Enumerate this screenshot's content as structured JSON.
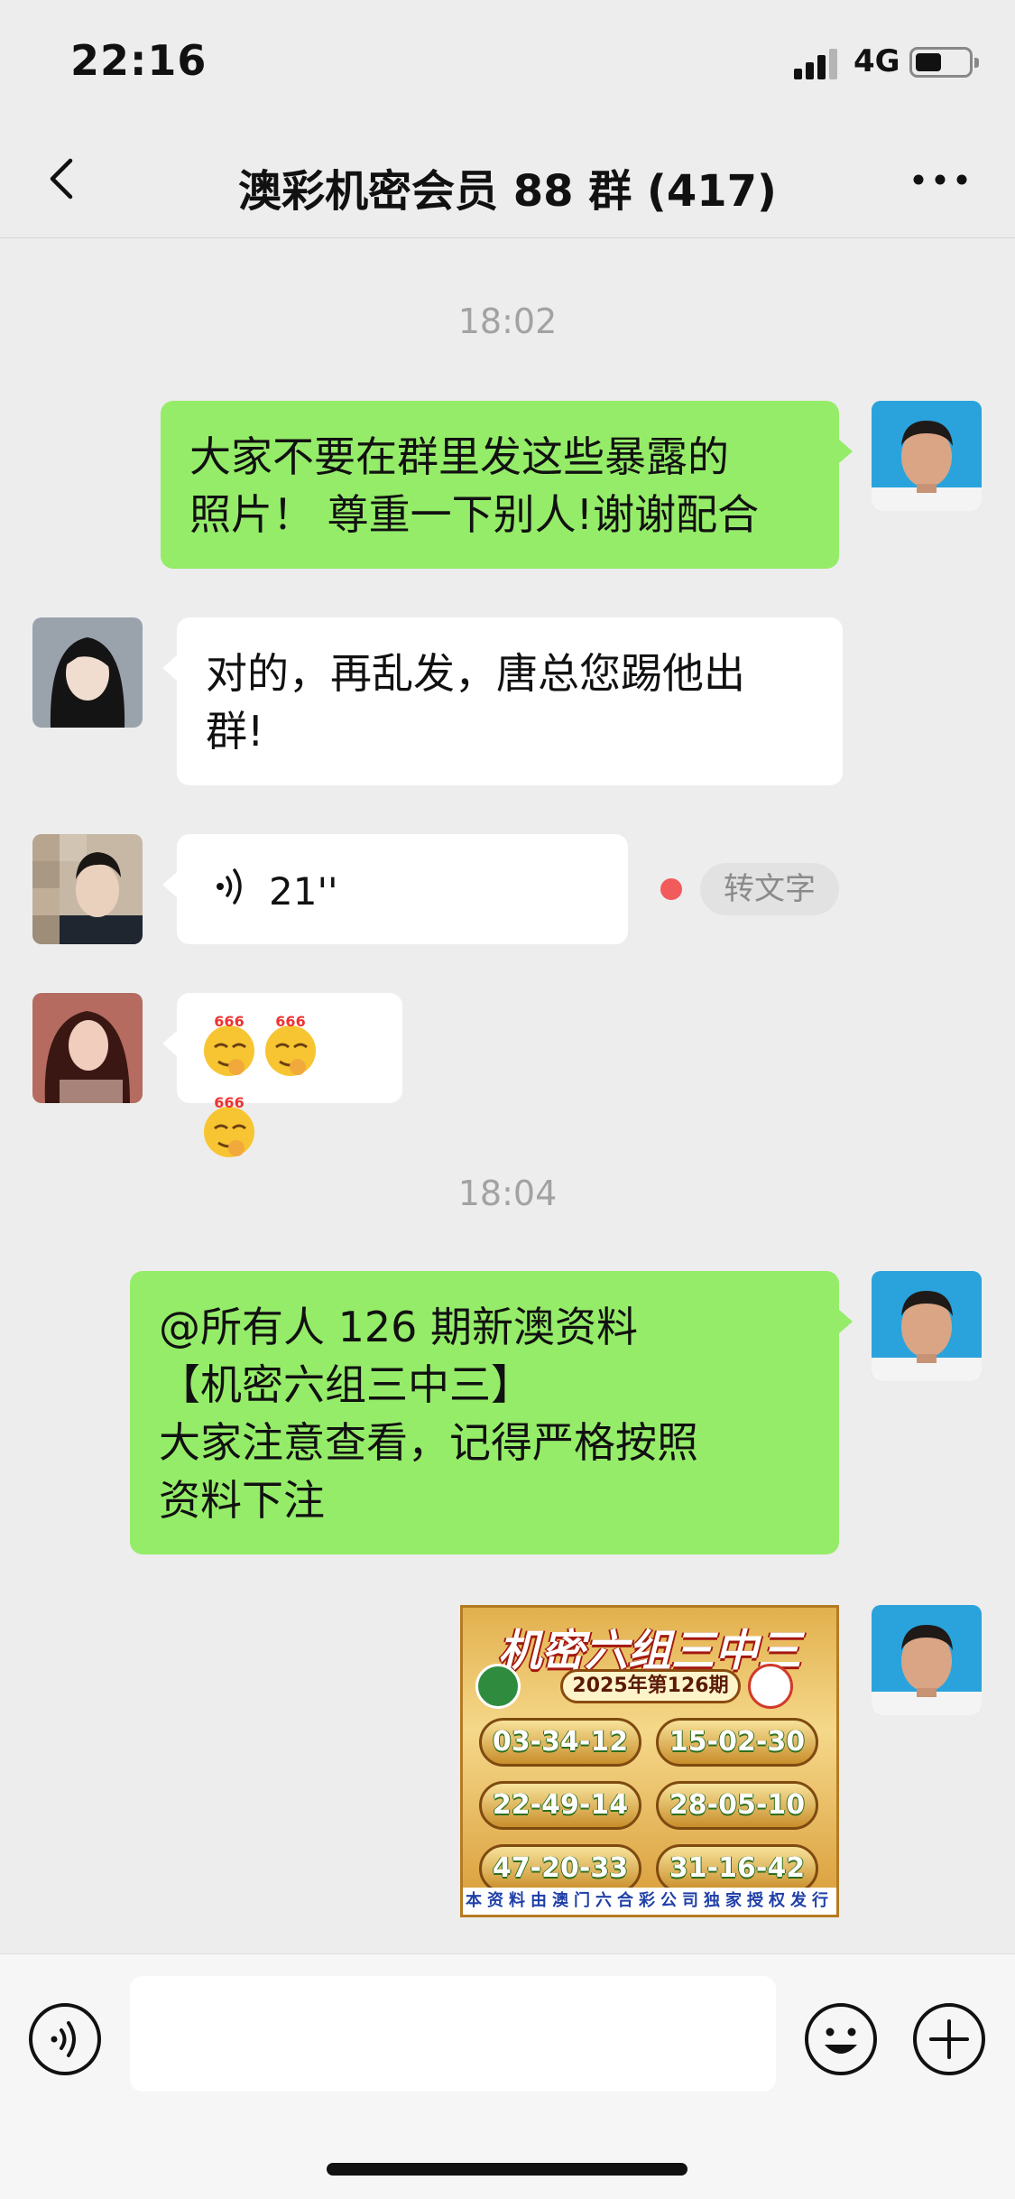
{
  "status_bar": {
    "time": "22:16",
    "network": "4G",
    "battery_level": 0.45
  },
  "header": {
    "back_icon": "chevron-left-icon",
    "title": "澳彩机密会员 88 群 (417)",
    "more_icon": "ellipsis-icon"
  },
  "messages": {
    "ts1": "18:02",
    "m1": {
      "lines": [
        "大家不要在群里发这些暴露的",
        "照片！ 尊重一下别人!谢谢配合"
      ]
    },
    "m2": {
      "lines": [
        "对的，再乱发，唐总您踢他出",
        "群!"
      ]
    },
    "m3": {
      "voice_length": "21''",
      "to_text": "转文字"
    },
    "m4": {
      "emoji": [
        "666",
        "666",
        "666"
      ]
    },
    "ts2": "18:04",
    "m5": {
      "lines": [
        "@所有人   126 期新澳资料",
        "【机密六组三中三】",
        "大家注意查看，记得严格按照",
        "资料下注"
      ]
    },
    "m6": {
      "title": "机密六组三中三",
      "issue": "2025年第126期",
      "numbers": [
        "03-34-12",
        "15-02-30",
        "22-49-14",
        "28-05-10",
        "47-20-33",
        "31-16-42"
      ],
      "footer": "本资料由澳门六合彩公司独家授权发行"
    }
  },
  "input_bar": {
    "voice_icon": "voice-icon",
    "placeholder": "",
    "emoji_icon": "smiley-icon",
    "plus_icon": "plus-circle-icon"
  },
  "colors": {
    "background": "#ededed",
    "outgoing_bubble": "#95ec69",
    "incoming_bubble": "#ffffff",
    "timestamp": "#a2a2a2"
  }
}
